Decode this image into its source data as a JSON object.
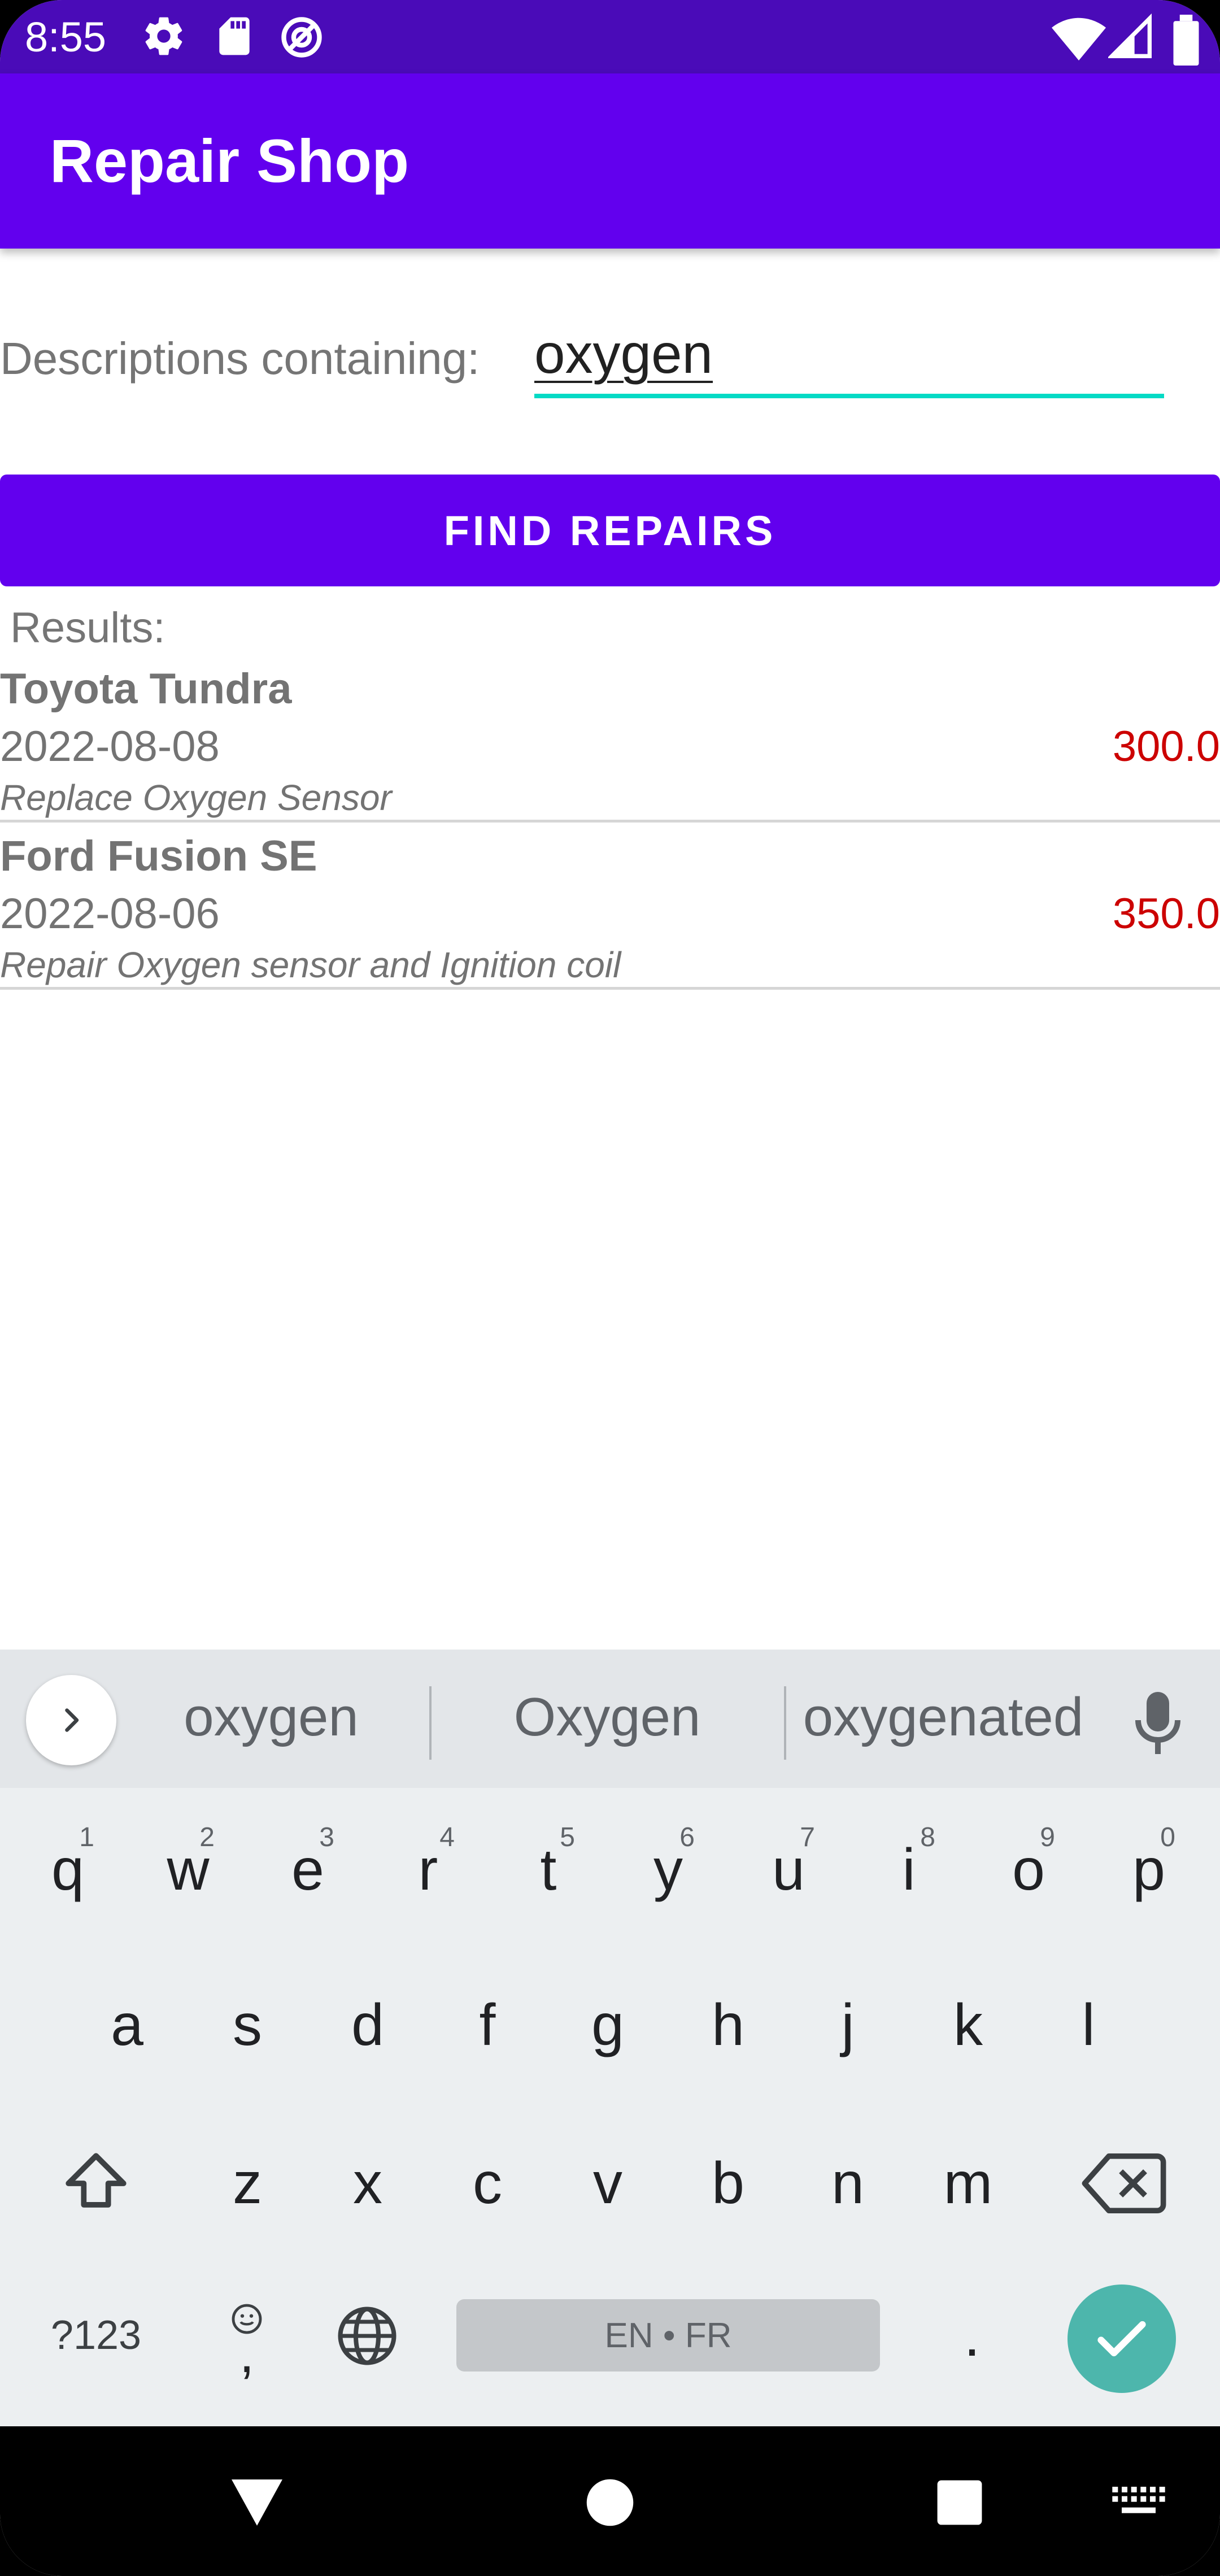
{
  "status_bar": {
    "time": "8:55",
    "icons": [
      "gear-icon",
      "sd-card-icon",
      "do-not-disturb-icon",
      "wifi-icon",
      "cell-signal-icon",
      "battery-icon"
    ]
  },
  "app_bar": {
    "title": "Repair Shop"
  },
  "form": {
    "label": "Descriptions containing:",
    "search_value": "oxygen",
    "button_label": "FIND REPAIRS"
  },
  "results": {
    "label": "Results:",
    "items": [
      {
        "vehicle": "Toyota Tundra",
        "date": "2022-08-08",
        "cost": "300.0",
        "description": "Replace Oxygen Sensor"
      },
      {
        "vehicle": "Ford Fusion SE",
        "date": "2022-08-06",
        "cost": "350.0",
        "description": "Repair Oxygen sensor and Ignition coil"
      }
    ]
  },
  "keyboard": {
    "suggestions": [
      "oxygen",
      "Oxygen",
      "oxygenated"
    ],
    "row1": [
      {
        "k": "q",
        "h": "1"
      },
      {
        "k": "w",
        "h": "2"
      },
      {
        "k": "e",
        "h": "3"
      },
      {
        "k": "r",
        "h": "4"
      },
      {
        "k": "t",
        "h": "5"
      },
      {
        "k": "y",
        "h": "6"
      },
      {
        "k": "u",
        "h": "7"
      },
      {
        "k": "i",
        "h": "8"
      },
      {
        "k": "o",
        "h": "9"
      },
      {
        "k": "p",
        "h": "0"
      }
    ],
    "row2": [
      "a",
      "s",
      "d",
      "f",
      "g",
      "h",
      "j",
      "k",
      "l"
    ],
    "row3": [
      "z",
      "x",
      "c",
      "v",
      "b",
      "n",
      "m"
    ],
    "symbols_label": "?123",
    "comma_label": ",",
    "period_label": ".",
    "space_label": "EN • FR"
  },
  "colors": {
    "primary": "#6200ee",
    "status_bar": "#4a0bb8",
    "accent": "#03dac5",
    "cost": "#cc0000",
    "enter_key": "#4db6ac"
  }
}
